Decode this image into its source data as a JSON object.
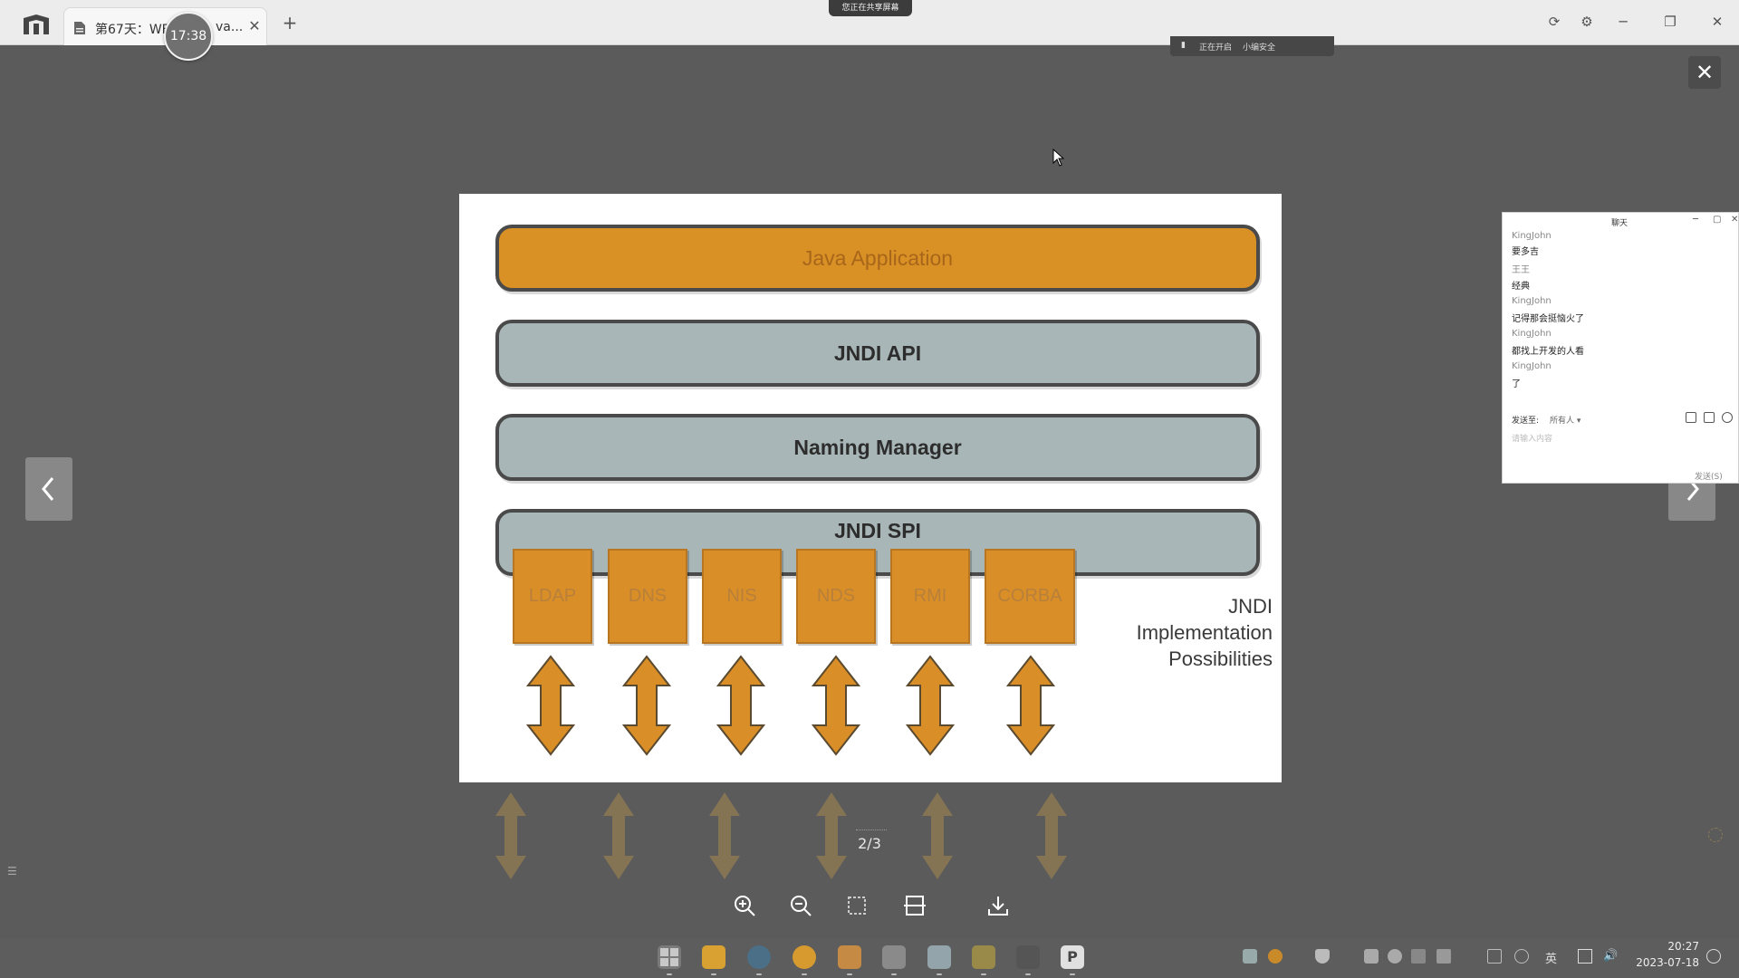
{
  "titlebar": {
    "tab_title_prefix": "第67天：WE",
    "tab_title_suffix": "va...",
    "tab_close": "✕",
    "new_tab": "+",
    "timer": "17:38",
    "share_status": "您正在共享屏幕",
    "sub_status_a": "正在开启",
    "sub_status_b": "小编安全",
    "window_controls": [
      "⟳",
      "⚙",
      "─",
      "❐",
      "✕"
    ]
  },
  "viewer": {
    "close": "✕",
    "page_indicator": "2/3",
    "toolbar": [
      "zoom-in-icon",
      "zoom-out-icon",
      "fit-icon",
      "rotate-icon",
      "download-icon"
    ]
  },
  "slide": {
    "layers": {
      "app": "Java Application",
      "api": "JNDI API",
      "naming_manager": "Naming Manager",
      "spi": "JNDI SPI"
    },
    "implementations": [
      "LDAP",
      "DNS",
      "NIS",
      "NDS",
      "RMI",
      "CORBA"
    ],
    "caption": [
      "JNDI",
      "Implementation",
      "Possibilities"
    ],
    "colors": {
      "orange": "#d99025",
      "gray_blue": "#a9b6b7",
      "border": "#4a4a4a"
    }
  },
  "chat": {
    "title": "聊天",
    "messages": [
      {
        "name": "KingJohn",
        "text": "要多吉"
      },
      {
        "name": "王王",
        "text": "经典"
      },
      {
        "name": "KingJohn",
        "text": "记得那会挺恼火了"
      },
      {
        "name": "KingJohn",
        "text": "都找上开发的人看"
      },
      {
        "name": "KingJohn",
        "text": "了"
      }
    ],
    "send_to_label": "发送至:",
    "recipient": "所有人 ▾",
    "input_placeholder": "请输入内容",
    "send_button": "发送(S)"
  },
  "taskbar": {
    "apps": [
      "start-icon",
      "file-explorer-icon",
      "edge-icon",
      "chrome-icon",
      "bird-icon",
      "typora-icon",
      "photos-icon",
      "ide-icon",
      "terminal-icon",
      "p-app-icon"
    ],
    "p_app_letter": "P",
    "input_method": "英",
    "time": "20:27",
    "date": "2023-07-18"
  }
}
